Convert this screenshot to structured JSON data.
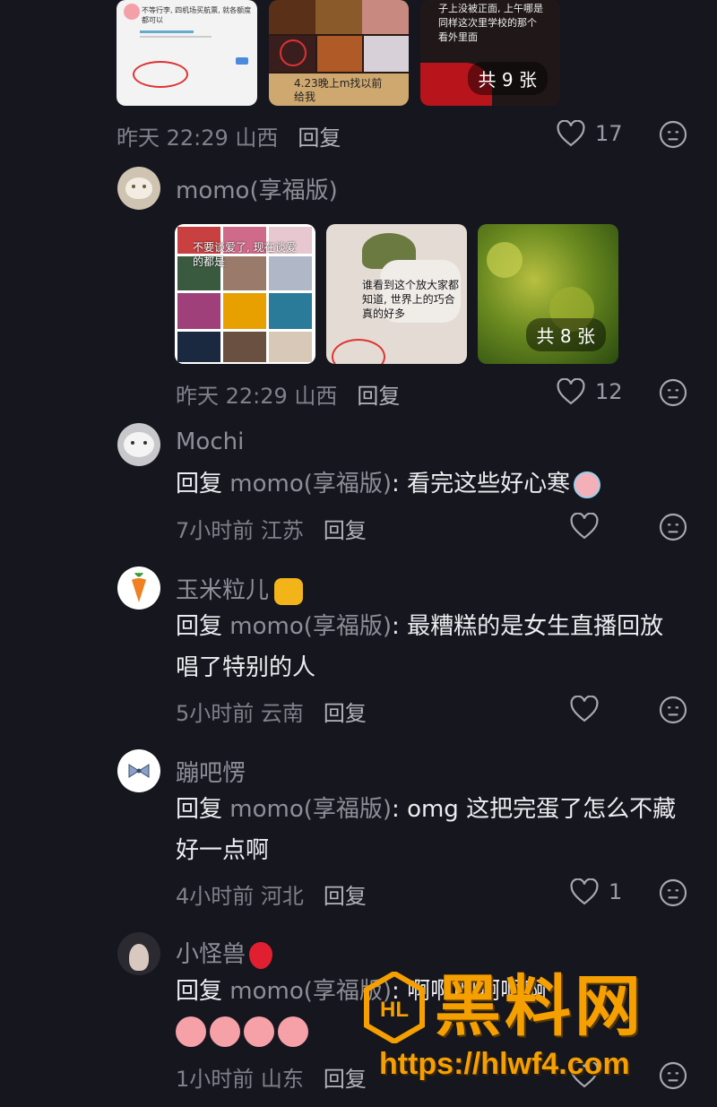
{
  "top_post": {
    "time_location": "昨天 22:29 山西",
    "reply_label": "回复",
    "likes": "17",
    "image_count_badge": "共 9 张",
    "images": [
      {
        "caption": "不等行李, 四机场买航票, 就各额度都可以"
      },
      {
        "caption": "4.23晚上m找以前给我"
      },
      {
        "caption": "子上没被正面, 上午哪是同样这次里学校的那个看外里面"
      }
    ]
  },
  "comments": [
    {
      "name": "momo(享福版)",
      "time_location": "昨天 22:29 山西",
      "reply_label": "回复",
      "likes": "12",
      "images": [
        {
          "caption": "不要谈爱了, 现在谈爱的都是"
        },
        {
          "caption": "谁看到这个放大家都知道, 世界上的巧合真的好多"
        },
        {
          "caption": "",
          "badge": "共 8 张"
        }
      ]
    },
    {
      "name": "Mochi",
      "reply_prefix": "回复",
      "mention": "momo(享福版)",
      "text": ": 看完这些好心寒",
      "time_location": "7小时前 江苏",
      "reply_label": "回复",
      "likes": ""
    },
    {
      "name": "玉米粒儿",
      "reply_prefix": "回复",
      "mention": "momo(享福版)",
      "text": ": 最糟糕的是女生直播回放唱了特别的人",
      "time_location": "5小时前 云南",
      "reply_label": "回复",
      "likes": ""
    },
    {
      "name": "蹦吧愣",
      "reply_prefix": "回复",
      "mention": "momo(享福版)",
      "text": ": omg 这把完蛋了怎么不藏好一点啊",
      "time_location": "4小时前 河北",
      "reply_label": "回复",
      "likes": "1"
    },
    {
      "name": "小怪兽",
      "reply_prefix": "回复",
      "mention": "momo(享福版)",
      "text": ": 啊啊啊啊啊啊",
      "time_location": "1小时前 山东",
      "reply_label": "回复",
      "likes": ""
    }
  ],
  "watermark": {
    "logo_text": "黑料网",
    "url": "https://hlwf4.com"
  },
  "colors": {
    "background": "#16161e",
    "watermark": "#f5a000"
  }
}
